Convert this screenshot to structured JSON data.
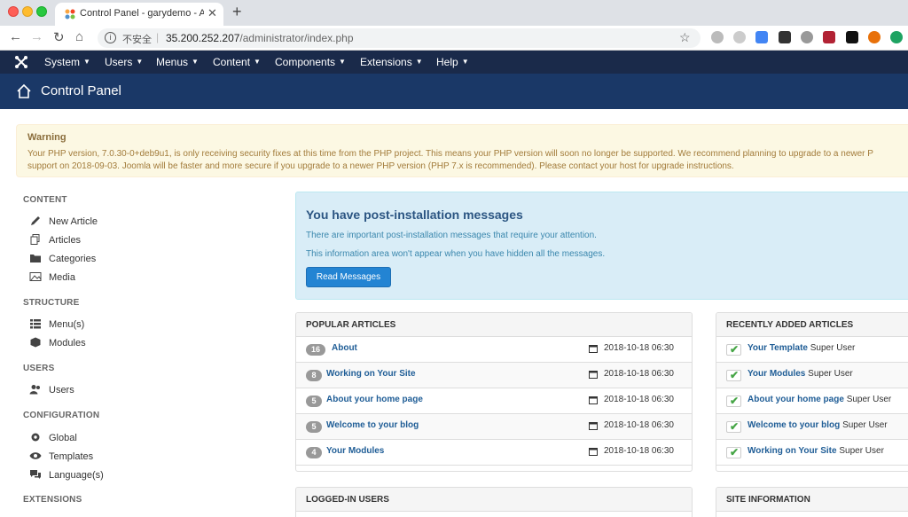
{
  "browser": {
    "tab_title": "Control Panel - garydemo - Ad",
    "insecure_label": "不安全",
    "url_host": "35.200.252.207",
    "url_path": "/administrator/index.php"
  },
  "topnav": {
    "items": [
      "System",
      "Users",
      "Menus",
      "Content",
      "Components",
      "Extensions",
      "Help"
    ]
  },
  "header": {
    "title": "Control Panel"
  },
  "warning": {
    "title": "Warning",
    "line1": "Your PHP version, 7.0.30-0+deb9u1, is only receiving security fixes at this time from the PHP project. This means your PHP version will soon no longer be supported. We recommend planning to upgrade to a newer P",
    "line2": "support on 2018-09-03. Joomla will be faster and more secure if you upgrade to a newer PHP version (PHP 7.x is recommended). Please contact your host for upgrade instructions."
  },
  "sidebar": {
    "content_head": "CONTENT",
    "new_article": "New Article",
    "articles": "Articles",
    "categories": "Categories",
    "media": "Media",
    "structure_head": "STRUCTURE",
    "menus": "Menu(s)",
    "modules": "Modules",
    "users_head": "USERS",
    "users": "Users",
    "config_head": "CONFIGURATION",
    "global": "Global",
    "templates": "Templates",
    "languages": "Language(s)",
    "extensions_head": "EXTENSIONS"
  },
  "postinstall": {
    "title": "You have post-installation messages",
    "p1": "There are important post-installation messages that require your attention.",
    "p2": "This information area won't appear when you have hidden all the messages.",
    "button": "Read Messages"
  },
  "popular": {
    "title": "POPULAR ARTICLES",
    "rows": [
      {
        "hits": "16",
        "title": "About",
        "date": "2018-10-18 06:30"
      },
      {
        "hits": "8",
        "title": "Working on Your Site",
        "date": "2018-10-18 06:30"
      },
      {
        "hits": "5",
        "title": "About your home page",
        "date": "2018-10-18 06:30"
      },
      {
        "hits": "5",
        "title": "Welcome to your blog",
        "date": "2018-10-18 06:30"
      },
      {
        "hits": "4",
        "title": "Your Modules",
        "date": "2018-10-18 06:30"
      }
    ]
  },
  "recent": {
    "title": "RECENTLY ADDED ARTICLES",
    "rows": [
      {
        "title": "Your Template",
        "author": "Super User"
      },
      {
        "title": "Your Modules",
        "author": "Super User"
      },
      {
        "title": "About your home page",
        "author": "Super User"
      },
      {
        "title": "Welcome to your blog",
        "author": "Super User"
      },
      {
        "title": "Working on Your Site",
        "author": "Super User"
      }
    ]
  },
  "logged_in": {
    "title": "LOGGED-IN USERS"
  },
  "site_info": {
    "title": "SITE INFORMATION"
  }
}
